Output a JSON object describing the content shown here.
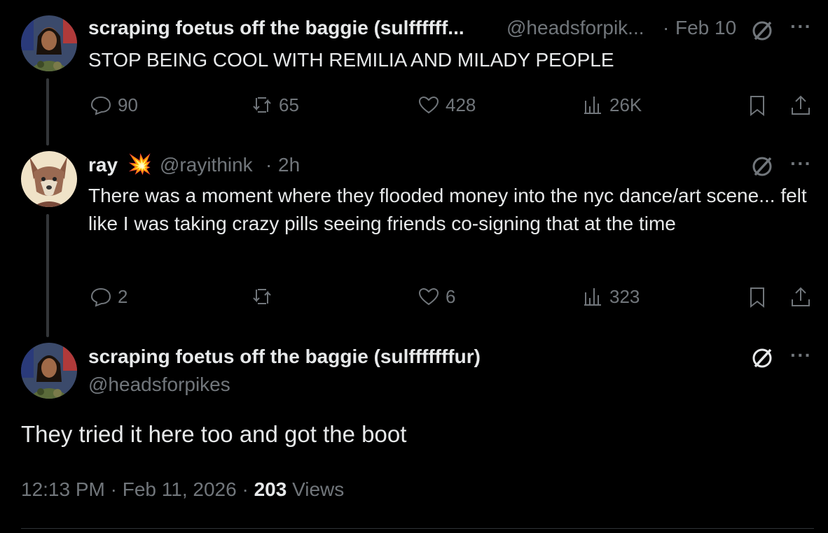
{
  "tweet1": {
    "name": "scraping foetus off the baggie (sulffffff...",
    "handle": "@headsforpik...",
    "sep": "·",
    "time": "Feb 10",
    "text": "STOP BEING COOL WITH REMILIA AND MILADY PEOPLE",
    "replies": "90",
    "reposts": "65",
    "likes": "428",
    "views": "26K"
  },
  "tweet2": {
    "name": "ray",
    "emoji": "💥",
    "handle": "@rayithink",
    "sep": "·",
    "time": "2h",
    "text": "There was a moment where they flooded money into the nyc dance/art scene... felt like I was taking crazy pills seeing friends co-signing that at the time",
    "replies": "2",
    "reposts": "",
    "likes": "6",
    "views": "323"
  },
  "main_tweet": {
    "name": "scraping foetus off the baggie (sulfffffffur)",
    "handle": "@headsforpikes",
    "text": "They tried it here too and got the boot",
    "time": "12:13 PM",
    "sep1": "·",
    "date": "Feb 11, 2026",
    "sep2": "·",
    "views_count": "203",
    "views_label": "Views"
  },
  "icons": {
    "reply": "reply-icon",
    "repost": "repost-icon",
    "like": "heart-icon",
    "views": "views-icon",
    "bookmark": "bookmark-icon",
    "share": "share-icon",
    "grok": "grok-icon",
    "more": "more-icon"
  },
  "colors": {
    "background": "#000000",
    "text": "#e7e9ea",
    "muted": "#71767b",
    "thread_line": "#333639"
  }
}
